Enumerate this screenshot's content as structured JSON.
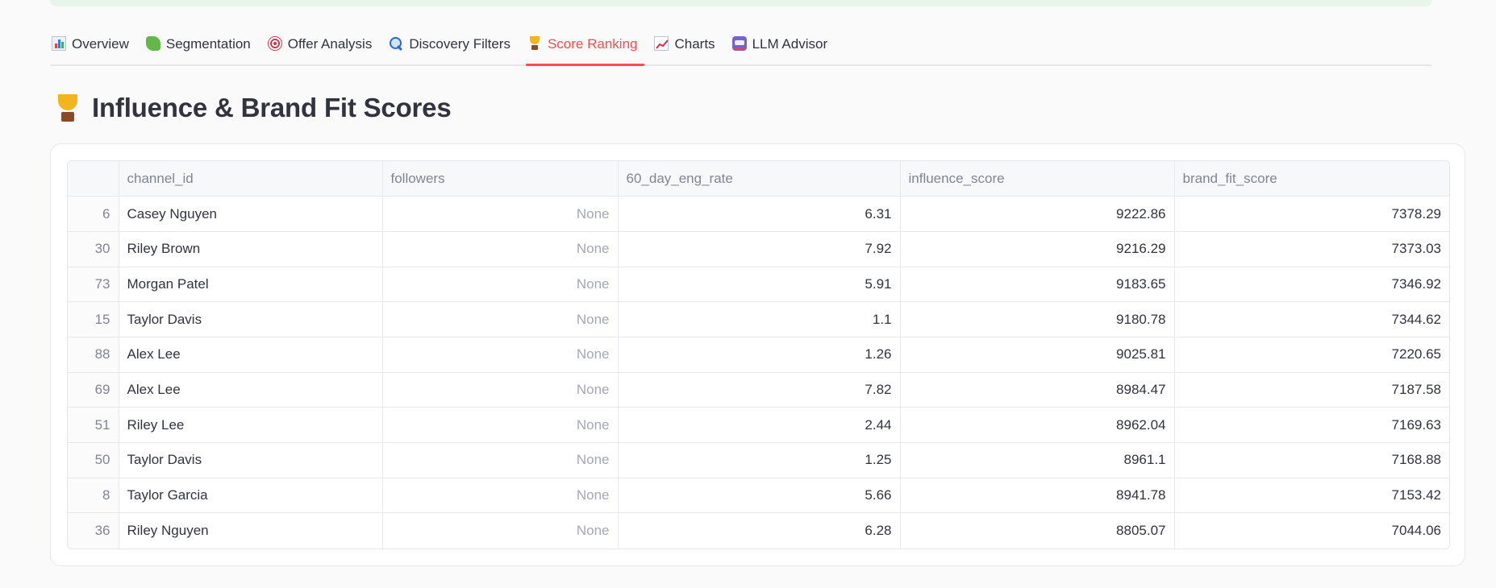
{
  "tabs": [
    {
      "label": "Overview",
      "icon": "bar-chart-icon"
    },
    {
      "label": "Segmentation",
      "icon": "puzzle-icon"
    },
    {
      "label": "Offer Analysis",
      "icon": "target-icon"
    },
    {
      "label": "Discovery Filters",
      "icon": "magnifier-icon"
    },
    {
      "label": "Score Ranking",
      "icon": "trophy-icon",
      "active": true
    },
    {
      "label": "Charts",
      "icon": "line-chart-icon"
    },
    {
      "label": "LLM Advisor",
      "icon": "robot-icon"
    }
  ],
  "page": {
    "title": "Influence & Brand Fit Scores",
    "title_icon": "trophy-icon"
  },
  "colors": {
    "accent": "#ff4b4b",
    "text": "#31333f",
    "muted": "#808495"
  },
  "table": {
    "columns": [
      "",
      "channel_id",
      "followers",
      "60_day_eng_rate",
      "influence_score",
      "brand_fit_score"
    ],
    "rows": [
      {
        "idx": "6",
        "channel_id": "Casey Nguyen",
        "followers": "None",
        "eng": "6.31",
        "influence": "9222.86",
        "brand_fit": "7378.29"
      },
      {
        "idx": "30",
        "channel_id": "Riley Brown",
        "followers": "None",
        "eng": "7.92",
        "influence": "9216.29",
        "brand_fit": "7373.03"
      },
      {
        "idx": "73",
        "channel_id": "Morgan Patel",
        "followers": "None",
        "eng": "5.91",
        "influence": "9183.65",
        "brand_fit": "7346.92"
      },
      {
        "idx": "15",
        "channel_id": "Taylor Davis",
        "followers": "None",
        "eng": "1.1",
        "influence": "9180.78",
        "brand_fit": "7344.62"
      },
      {
        "idx": "88",
        "channel_id": "Alex Lee",
        "followers": "None",
        "eng": "1.26",
        "influence": "9025.81",
        "brand_fit": "7220.65"
      },
      {
        "idx": "69",
        "channel_id": "Alex Lee",
        "followers": "None",
        "eng": "7.82",
        "influence": "8984.47",
        "brand_fit": "7187.58"
      },
      {
        "idx": "51",
        "channel_id": "Riley Lee",
        "followers": "None",
        "eng": "2.44",
        "influence": "8962.04",
        "brand_fit": "7169.63"
      },
      {
        "idx": "50",
        "channel_id": "Taylor Davis",
        "followers": "None",
        "eng": "1.25",
        "influence": "8961.1",
        "brand_fit": "7168.88"
      },
      {
        "idx": "8",
        "channel_id": "Taylor Garcia",
        "followers": "None",
        "eng": "5.66",
        "influence": "8941.78",
        "brand_fit": "7153.42"
      },
      {
        "idx": "36",
        "channel_id": "Riley Nguyen",
        "followers": "None",
        "eng": "6.28",
        "influence": "8805.07",
        "brand_fit": "7044.06"
      }
    ]
  }
}
